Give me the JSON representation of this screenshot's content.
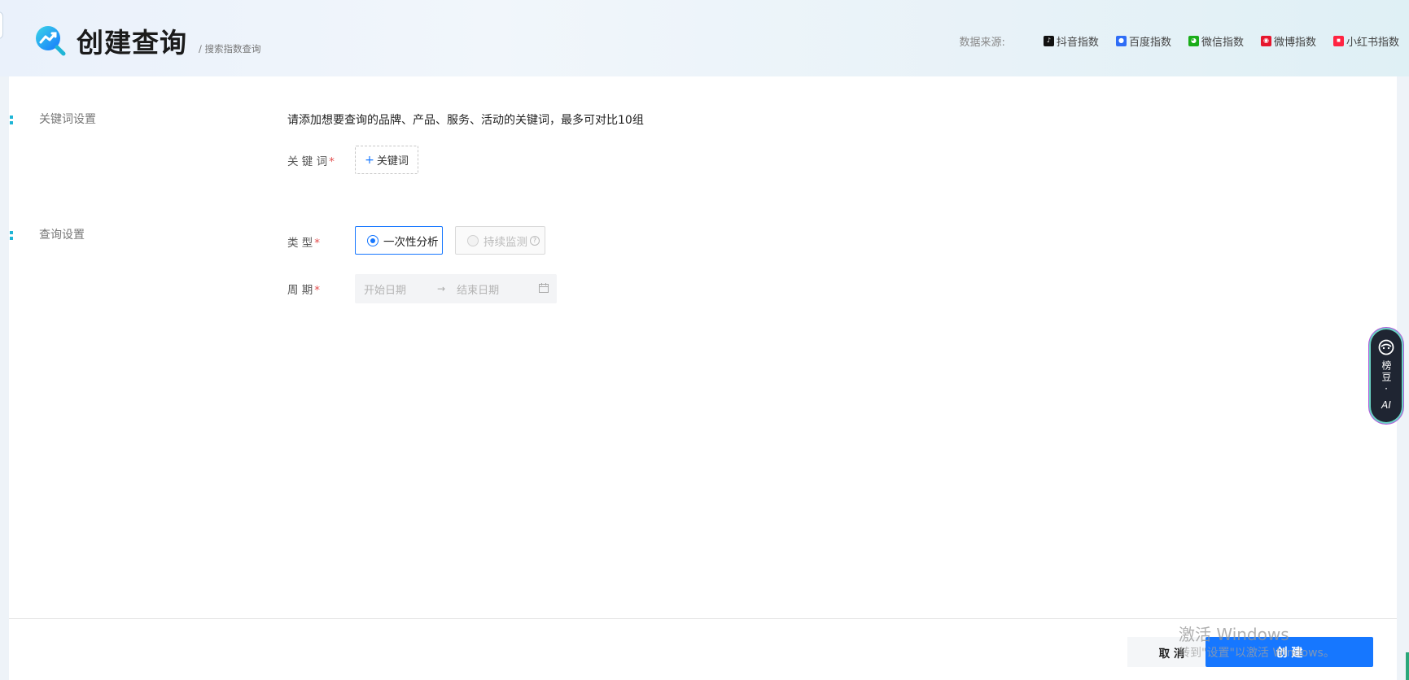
{
  "header": {
    "title": "创建查询",
    "breadcrumb": "/ 搜索指数查询",
    "sources_label": "数据来源:",
    "sources": [
      {
        "label": "抖音指数",
        "icon": "douyin-icon",
        "color": "#111111"
      },
      {
        "label": "百度指数",
        "icon": "baidu-icon",
        "color": "#2f6df6"
      },
      {
        "label": "微信指数",
        "icon": "wechat-icon",
        "color": "#1aad19"
      },
      {
        "label": "微博指数",
        "icon": "weibo-icon",
        "color": "#e6162d"
      },
      {
        "label": "小红书指数",
        "icon": "xiaohongshu-icon",
        "color": "#ff2442"
      }
    ]
  },
  "keyword_section": {
    "title": "关键词设置",
    "hint": "请添加想要查询的品牌、产品、服务、活动的关键词，最多可对比10组",
    "label": "关 键 词",
    "required_mark": "*",
    "add_button": "关键词"
  },
  "query_section": {
    "title": "查询设置",
    "type_label": "类 型",
    "period_label": "周 期",
    "required_mark": "*",
    "type_options": [
      {
        "label": "一次性分析",
        "selected": true
      },
      {
        "label": "持续监测",
        "selected": false,
        "disabled": true
      }
    ],
    "start_placeholder": "开始日期",
    "end_placeholder": "结束日期"
  },
  "footer": {
    "cancel": "取 消",
    "create": "创 建"
  },
  "ai_assistant": {
    "label_vertical": "榜豆·",
    "label_ai": "AI"
  },
  "watermark": {
    "line1": "激活 Windows",
    "line2": "转到\"设置\"以激活 Windows。"
  },
  "colors": {
    "primary": "#1677ff",
    "accent": "#1fb5d6",
    "required": "#e34d4d"
  }
}
